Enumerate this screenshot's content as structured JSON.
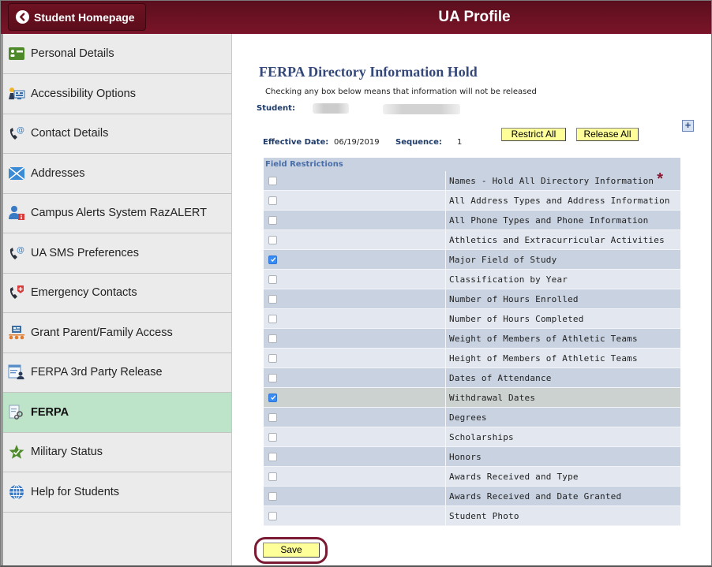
{
  "header": {
    "back_button": "Student Homepage",
    "title": "UA Profile"
  },
  "sidebar": {
    "items": [
      {
        "label": "Personal Details",
        "icon": "id-card-icon",
        "active": false
      },
      {
        "label": "Accessibility Options",
        "icon": "accessibility-icon",
        "active": false
      },
      {
        "label": "Contact Details",
        "icon": "phone-at-icon",
        "active": false
      },
      {
        "label": "Addresses",
        "icon": "envelope-icon",
        "active": false
      },
      {
        "label": "Campus Alerts System RazALERT",
        "icon": "user-alert-icon",
        "active": false
      },
      {
        "label": "UA SMS Preferences",
        "icon": "phone-at-icon",
        "active": false
      },
      {
        "label": "Emergency Contacts",
        "icon": "phone-emergency-icon",
        "active": false
      },
      {
        "label": "Grant Parent/Family Access",
        "icon": "family-access-icon",
        "active": false
      },
      {
        "label": "FERPA 3rd Party Release",
        "icon": "document-person-icon",
        "active": false
      },
      {
        "label": "FERPA",
        "icon": "document-gear-icon",
        "active": true
      },
      {
        "label": "Military Status",
        "icon": "star-check-icon",
        "active": false
      },
      {
        "label": "Help for Students",
        "icon": "globe-icon",
        "active": false
      }
    ]
  },
  "main": {
    "title": "FERPA Directory Information Hold",
    "instruction": "Checking any box below means that information will not be released",
    "student_label": "Student:",
    "effective_date_label": "Effective Date:",
    "effective_date": "06/19/2019",
    "sequence_label": "Sequence:",
    "sequence": "1",
    "restrict_all": "Restrict All",
    "release_all": "Release All",
    "add_icon": "+",
    "grid_title": "Field Restrictions",
    "required_marker": "*",
    "restrictions": [
      {
        "label": "Names - Hold All Directory Information",
        "checked": false,
        "required": true
      },
      {
        "label": "All Address Types and Address Information",
        "checked": false
      },
      {
        "label": "All Phone Types and Phone Information",
        "checked": false
      },
      {
        "label": "Athletics and Extracurricular Activities",
        "checked": false
      },
      {
        "label": "Major Field of Study",
        "checked": true
      },
      {
        "label": "Classification by Year",
        "checked": false
      },
      {
        "label": "Number of Hours Enrolled",
        "checked": false
      },
      {
        "label": "Number of Hours Completed",
        "checked": false
      },
      {
        "label": "Weight of Members of Athletic Teams",
        "checked": false
      },
      {
        "label": "Height of Members of Athletic Teams",
        "checked": false
      },
      {
        "label": "Dates of Attendance",
        "checked": false
      },
      {
        "label": "Withdrawal Dates",
        "checked": true,
        "highlighted": true
      },
      {
        "label": "Degrees",
        "checked": false
      },
      {
        "label": "Scholarships",
        "checked": false
      },
      {
        "label": "Honors",
        "checked": false
      },
      {
        "label": "Awards Received and Type",
        "checked": false
      },
      {
        "label": "Awards Received and Date Granted",
        "checked": false
      },
      {
        "label": "Student Photo",
        "checked": false
      }
    ],
    "save": "Save"
  },
  "colors": {
    "brand": "#7b1428",
    "active_nav": "#bde3c9",
    "title_blue": "#35487a",
    "button_yellow": "#ffff99",
    "checkbox_checked": "#3a8cf5"
  }
}
